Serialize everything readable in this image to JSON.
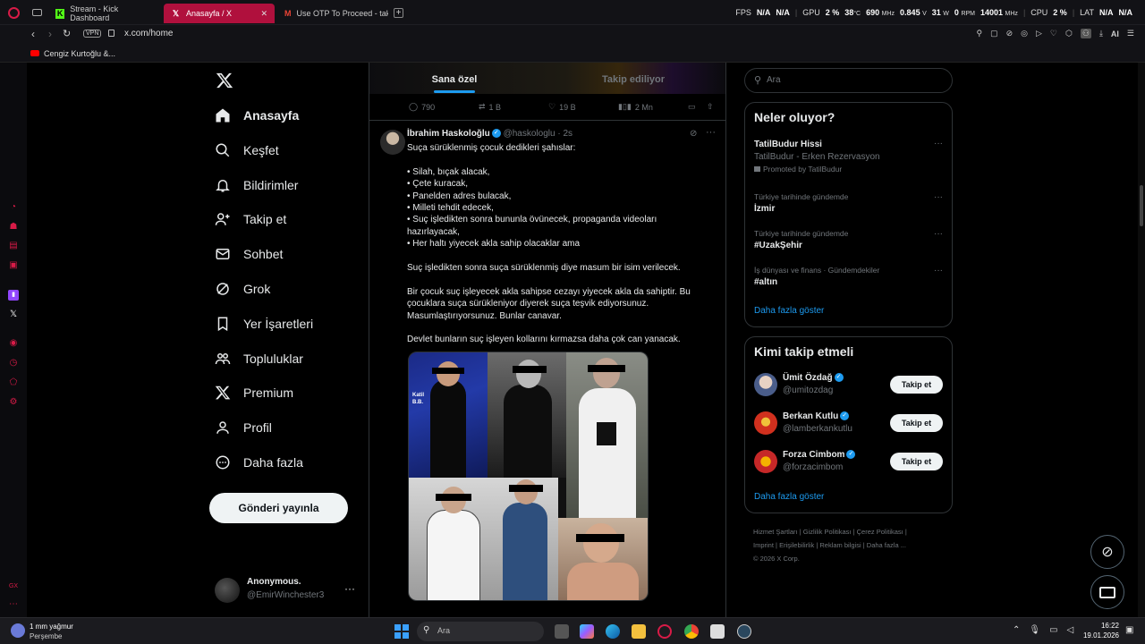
{
  "browser": {
    "tabs": [
      {
        "label": "Stream - Kick Dashboard",
        "active": false
      },
      {
        "label": "Anasayfa / X",
        "active": true
      },
      {
        "label": "Use OTP To Proceed - takı",
        "active": false
      }
    ],
    "url": "x.com/home",
    "vpn_label": "VPN",
    "bookmark": "Cengiz Kurtoğlu &...",
    "ai_label": "AI"
  },
  "hud": {
    "fps_label": "FPS",
    "fps_val1": "N/A",
    "fps_val2": "N/A",
    "gpu_label": "GPU",
    "gpu_pct": "2 %",
    "gpu_temp": "38",
    "gpu_temp_unit": "°C",
    "gpu_clock": "690",
    "gpu_clock_unit": "MHz",
    "gpu_volt": "0.845",
    "gpu_volt_unit": "V",
    "gpu_watt": "31",
    "gpu_watt_unit": "W",
    "gpu_rpm": "0",
    "gpu_rpm_unit": "RPM",
    "gpu_mem": "14001",
    "gpu_mem_unit": "MHz",
    "cpu_label": "CPU",
    "cpu_pct": "2 %",
    "lat_label": "LAT",
    "lat_val1": "N/A",
    "lat_val2": "N/A"
  },
  "nav": {
    "items": [
      {
        "label": "Anasayfa",
        "icon": "home-icon"
      },
      {
        "label": "Keşfet",
        "icon": "search-icon"
      },
      {
        "label": "Bildirimler",
        "icon": "bell-icon"
      },
      {
        "label": "Takip et",
        "icon": "add-user-icon"
      },
      {
        "label": "Sohbet",
        "icon": "mail-icon"
      },
      {
        "label": "Grok",
        "icon": "grok-icon"
      },
      {
        "label": "Yer İşaretleri",
        "icon": "bookmark-icon"
      },
      {
        "label": "Topluluklar",
        "icon": "communities-icon"
      },
      {
        "label": "Premium",
        "icon": "x-logo-icon"
      },
      {
        "label": "Profil",
        "icon": "profile-icon"
      },
      {
        "label": "Daha fazla",
        "icon": "more-circle-icon"
      }
    ],
    "post_button": "Gönderi yayınla",
    "account_name": "Anonymous.",
    "account_handle": "@EmirWinchester3"
  },
  "feed": {
    "tabs": [
      "Sana özel",
      "Takip ediliyor"
    ],
    "prev_actions": {
      "replies": "790",
      "reposts": "1 B",
      "likes": "19 B",
      "views": "2 Mn"
    },
    "tweet": {
      "author": "İbrahim Haskoloğlu",
      "handle": "@haskologlu",
      "sep": "·",
      "time": "2s",
      "lines": [
        "Suça sürüklenmiş çocuk dedikleri şahıslar:",
        "",
        "• Silah, bıçak alacak,",
        "• Çete kuracak,",
        "• Panelden adres bulacak,",
        "• Milleti tehdit edecek,",
        "• Suç işledikten sonra bununla övünecek, propaganda videoları",
        "hazırlayacak,",
        "• Her haltı yiyecek akla sahip olacaklar ama",
        "",
        "Suç işledikten sonra suça sürüklenmiş diye masum bir isim verilecek.",
        "",
        "Bir çocuk suç işleyecek akla sahipse cezayı yiyecek akla da sahiptir. Bu",
        "çocuklara suça sürükleniyor diyerek suça teşvik ediyorsunuz.",
        "Masumlaştırıyorsunuz. Bunlar canavar.",
        "",
        "Devlet bunların suç işleyen kollarını kırmazsa daha çok can yanacak."
      ],
      "photo_caption": "Katil B.B."
    }
  },
  "sidebar": {
    "search_placeholder": "Ara",
    "trends_title": "Neler oluyor?",
    "trends": [
      {
        "meta": "",
        "name": "TatilBudur Hissi",
        "sub": "TatilBudur - Erken Rezervasyon",
        "promo": "Promoted by TatilBudur"
      },
      {
        "meta": "Türkiye tarihinde gündemde",
        "name": "İzmir"
      },
      {
        "meta": "Türkiye tarihinde gündemde",
        "name": "#UzakŞehir"
      },
      {
        "meta": "İş dünyası ve finans · Gündemdekiler",
        "name": "#altın"
      }
    ],
    "show_more": "Daha fazla göster",
    "who_title": "Kimi takip etmeli",
    "who": [
      {
        "name": "Ümit Özdağ",
        "handle": "@umitozdag"
      },
      {
        "name": "Berkan Kutlu",
        "handle": "@lamberkankutlu"
      },
      {
        "name": "Forza Cimbom",
        "handle": "@forzacimbom"
      }
    ],
    "follow_label": "Takip et",
    "who_show_more": "Daha fazla göster",
    "footer_links": [
      "Hizmet Şartları",
      "Gizlilik Politikası",
      "Çerez Politikası",
      "Imprint",
      "Erişilebilirlik",
      "Reklam bilgisi",
      "Daha fazla ..."
    ],
    "footer_separator": "|",
    "copyright": "© 2026 X Corp."
  },
  "taskbar": {
    "weather_temp": "1 mm yağmur",
    "weather_day": "Perşembe",
    "search_placeholder": "Ara",
    "time": "16:22",
    "date": "19.01.2026"
  },
  "colors": {
    "accent": "#1d9bf0",
    "opera_red": "#d81b47",
    "tab_active": "#b0103d"
  }
}
